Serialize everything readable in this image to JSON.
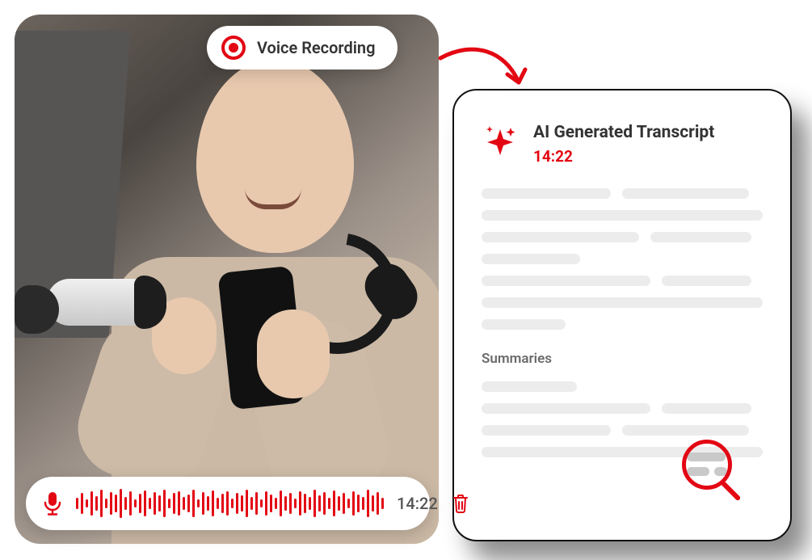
{
  "colors": {
    "accent": "#e30613"
  },
  "voice_pill": {
    "label": "Voice Recording"
  },
  "audio_bar": {
    "timestamp": "14:22",
    "waveform_heights": [
      14,
      26,
      10,
      30,
      18,
      34,
      12,
      28,
      22,
      36,
      16,
      30,
      10,
      24,
      32,
      14,
      28,
      20,
      34,
      12,
      26,
      30,
      16,
      22,
      34,
      10,
      28,
      18,
      32,
      14,
      24,
      30,
      12,
      26,
      20,
      34,
      16,
      28,
      10,
      30,
      22,
      14,
      32,
      18,
      26,
      12,
      30,
      24,
      16,
      34,
      20,
      28,
      14,
      32,
      18,
      26,
      12,
      30,
      22,
      16,
      34,
      20,
      28,
      14
    ]
  },
  "transcript": {
    "title": "AI Generated Transcript",
    "timestamp": "14:22",
    "summaries_label": "Summaries"
  }
}
